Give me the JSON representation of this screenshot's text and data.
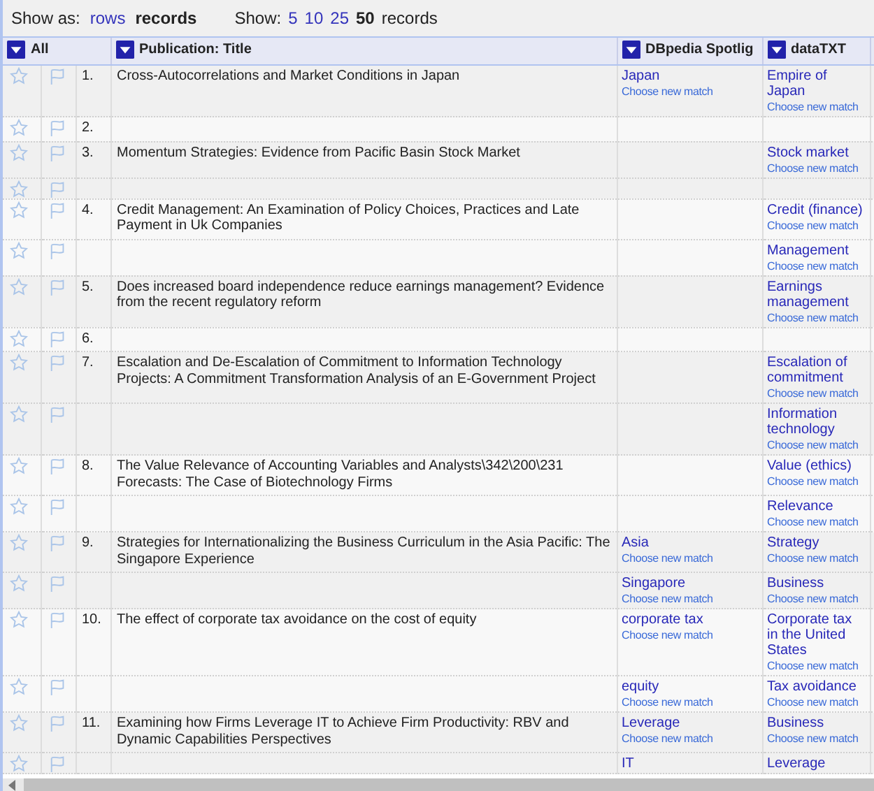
{
  "view": {
    "label": "Show as:",
    "modes": [
      {
        "label": "rows",
        "selected": false
      },
      {
        "label": "records",
        "selected": true
      }
    ]
  },
  "page_size": {
    "label": "Show:",
    "options": [
      {
        "label": "5",
        "selected": false
      },
      {
        "label": "10",
        "selected": false
      },
      {
        "label": "25",
        "selected": false
      },
      {
        "label": "50",
        "selected": true
      }
    ],
    "suffix": "records"
  },
  "table": {
    "columns": [
      {
        "label": "All"
      },
      {
        "label": "Publication: Title"
      },
      {
        "label": "DBpedia Spotlig"
      },
      {
        "label": "dataTXT"
      }
    ],
    "records": [
      {
        "rows": [
          {
            "starred": false,
            "flagged": false,
            "index": "1.",
            "title": "Cross-Autocorrelations and Market Conditions in Japan",
            "dbpedia": {
              "name": "Japan",
              "action": "Choose new match"
            },
            "datatxt": {
              "name": "Empire of Japan",
              "action": "Choose new match"
            }
          }
        ]
      },
      {
        "rows": [
          {
            "starred": false,
            "flagged": false,
            "index": "2."
          }
        ]
      },
      {
        "rows": [
          {
            "starred": false,
            "flagged": false,
            "index": "3.",
            "title": "Momentum Strategies: Evidence from Pacific Basin Stock Market",
            "datatxt": {
              "name": "Stock market",
              "action": "Choose new match"
            }
          },
          {
            "starred": false,
            "flagged": false
          }
        ]
      },
      {
        "rows": [
          {
            "starred": false,
            "flagged": false,
            "index": "4.",
            "title": "Credit Management: An Examination of Policy Choices, Practices and Late Payment in Uk Companies",
            "datatxt": {
              "name": "Credit (finance)",
              "action": "Choose new match"
            }
          },
          {
            "starred": false,
            "flagged": false,
            "datatxt": {
              "name": "Management",
              "action": "Choose new match"
            }
          }
        ]
      },
      {
        "rows": [
          {
            "starred": false,
            "flagged": false,
            "index": "5.",
            "title": "Does increased board independence reduce earnings management? Evidence from the recent regulatory reform",
            "datatxt": {
              "name": "Earnings management",
              "action": "Choose new match"
            }
          }
        ]
      },
      {
        "rows": [
          {
            "starred": false,
            "flagged": false,
            "index": "6."
          }
        ]
      },
      {
        "rows": [
          {
            "starred": false,
            "flagged": false,
            "index": "7.",
            "title": "Escalation and De-Escalation of Commitment to Information Technology Projects: A Commitment Transformation Analysis of an E-Government Project",
            "datatxt": {
              "name": "Escalation of commitment",
              "action": "Choose new match"
            }
          },
          {
            "starred": false,
            "flagged": false,
            "datatxt": {
              "name": "Information technology",
              "action": "Choose new match"
            }
          }
        ]
      },
      {
        "rows": [
          {
            "starred": false,
            "flagged": false,
            "index": "8.",
            "title": "The Value Relevance of Accounting Variables and Analysts\\342\\200\\231 Forecasts: The Case of Biotechnology Firms",
            "datatxt": {
              "name": "Value (ethics)",
              "action": "Choose new match"
            }
          },
          {
            "starred": false,
            "flagged": false,
            "datatxt": {
              "name": "Relevance",
              "action": "Choose new match"
            }
          }
        ]
      },
      {
        "rows": [
          {
            "starred": false,
            "flagged": false,
            "index": "9.",
            "title": "Strategies for Internationalizing the Business Curriculum in the Asia Pacific: The Singapore Experience",
            "dbpedia": {
              "name": "Asia",
              "action": "Choose new match"
            },
            "datatxt": {
              "name": "Strategy",
              "action": "Choose new match"
            }
          },
          {
            "starred": false,
            "flagged": false,
            "dbpedia": {
              "name": "Singapore",
              "action": "Choose new match"
            },
            "datatxt": {
              "name": "Business",
              "action": "Choose new match"
            }
          }
        ]
      },
      {
        "rows": [
          {
            "starred": false,
            "flagged": false,
            "index": "10.",
            "title": "The effect of corporate tax avoidance on the cost of equity",
            "dbpedia": {
              "name": "corporate tax",
              "action": "Choose new match"
            },
            "datatxt": {
              "name": "Corporate tax in the United States",
              "action": "Choose new match"
            }
          },
          {
            "starred": false,
            "flagged": false,
            "dbpedia": {
              "name": "equity",
              "action": "Choose new match"
            },
            "datatxt": {
              "name": "Tax avoidance",
              "action": "Choose new match"
            }
          }
        ]
      },
      {
        "rows": [
          {
            "starred": false,
            "flagged": false,
            "index": "11.",
            "title": "Examining how Firms Leverage IT to Achieve Firm Productivity: RBV and Dynamic Capabilities Perspectives",
            "dbpedia": {
              "name": "Leverage",
              "action": "Choose new match"
            },
            "datatxt": {
              "name": "Business",
              "action": "Choose new match"
            }
          },
          {
            "starred": false,
            "flagged": false,
            "dbpedia": {
              "name": "IT"
            },
            "datatxt": {
              "name": "Leverage"
            }
          }
        ]
      }
    ]
  }
}
